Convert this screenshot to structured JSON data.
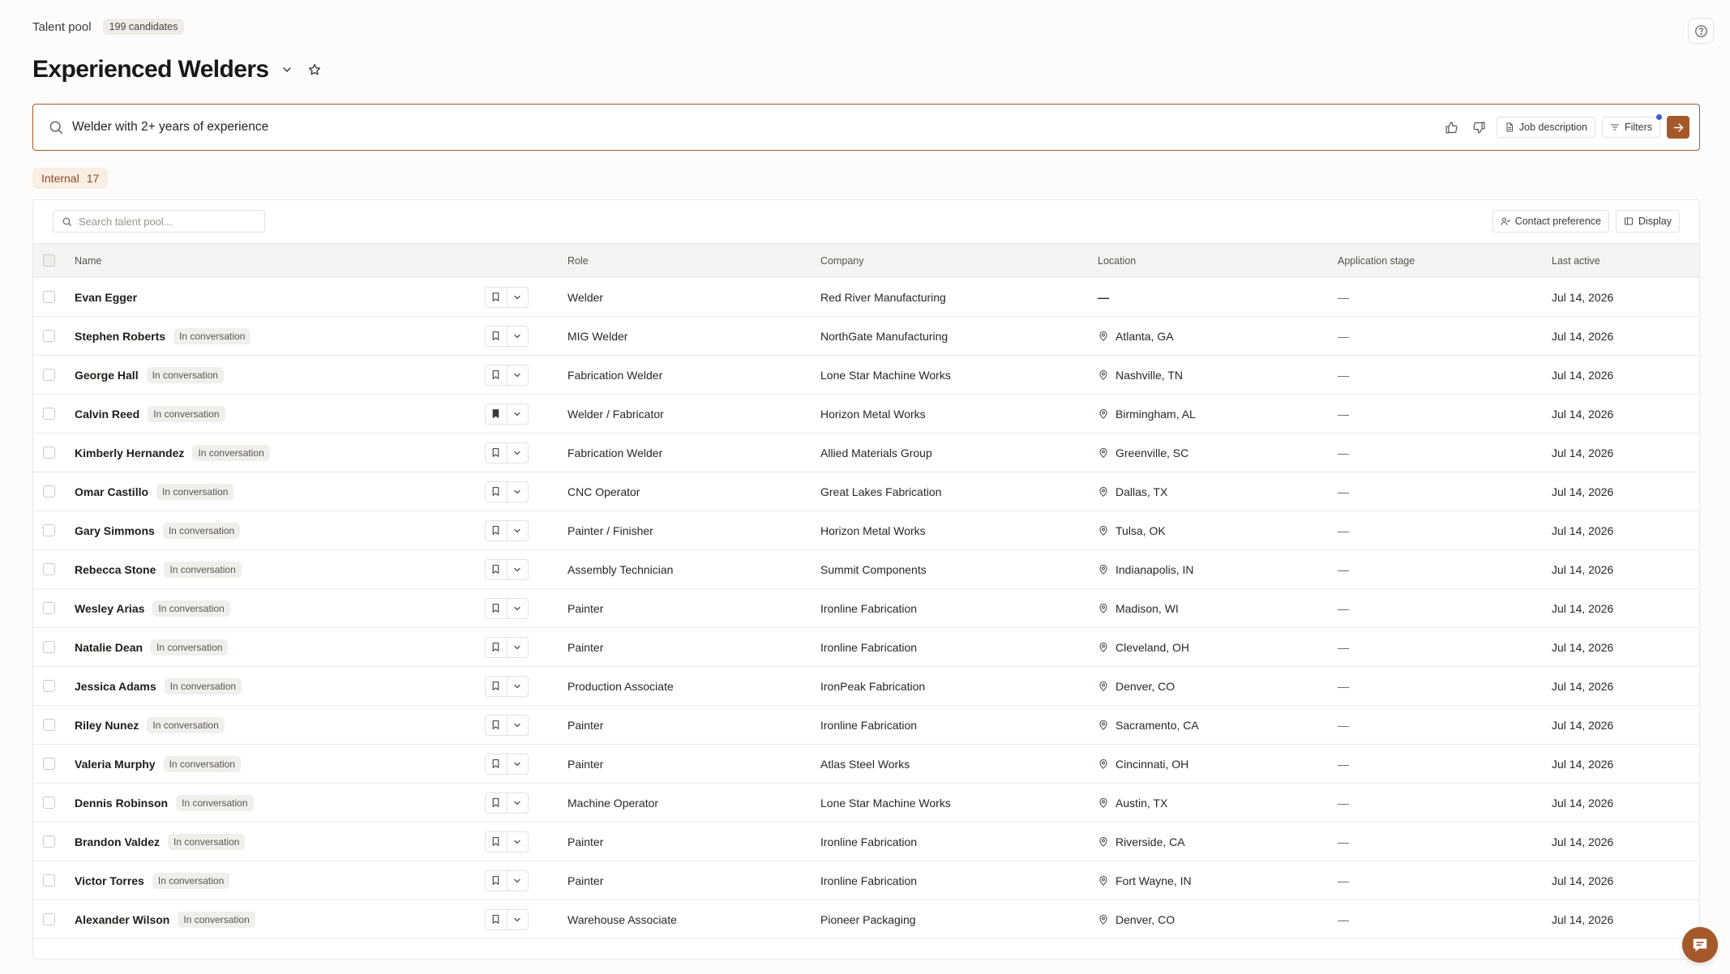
{
  "header": {
    "breadcrumb": "Talent pool",
    "candidate_count": "199 candidates",
    "title": "Experienced Welders"
  },
  "search": {
    "query": "Welder with 2+ years of experience",
    "job_description_label": "Job description",
    "filters_label": "Filters"
  },
  "tabs": {
    "internal_label": "Internal",
    "internal_count": "17"
  },
  "toolbar": {
    "search_placeholder": "Search talent pool...",
    "contact_preference_label": "Contact preference",
    "display_label": "Display"
  },
  "columns": {
    "name": "Name",
    "role": "Role",
    "company": "Company",
    "location": "Location",
    "stage": "Application stage",
    "last_active": "Last active"
  },
  "colors": {
    "accent": "#a5582a",
    "notification_dot": "#3b5bdb"
  },
  "rows": [
    {
      "name": "Evan Egger",
      "status": "",
      "role": "Welder",
      "company": "Red River Manufacturing",
      "location": "",
      "location_placeholder": "—",
      "stage": "—",
      "last_active": "Jul 14, 2026",
      "bookmarked": false
    },
    {
      "name": "Stephen Roberts",
      "status": "In conversation",
      "role": "MIG Welder",
      "company": "NorthGate Manufacturing",
      "location": "Atlanta, GA",
      "stage": "—",
      "last_active": "Jul 14, 2026",
      "bookmarked": false
    },
    {
      "name": "George Hall",
      "status": "In conversation",
      "role": "Fabrication Welder",
      "company": "Lone Star Machine Works",
      "location": "Nashville, TN",
      "stage": "—",
      "last_active": "Jul 14, 2026",
      "bookmarked": false
    },
    {
      "name": "Calvin Reed",
      "status": "In conversation",
      "role": "Welder / Fabricator",
      "company": "Horizon Metal Works",
      "location": "Birmingham, AL",
      "stage": "—",
      "last_active": "Jul 14, 2026",
      "bookmarked": true
    },
    {
      "name": "Kimberly Hernandez",
      "status": "In conversation",
      "role": "Fabrication Welder",
      "company": "Allied Materials Group",
      "location": "Greenville, SC",
      "stage": "—",
      "last_active": "Jul 14, 2026",
      "bookmarked": false
    },
    {
      "name": "Omar Castillo",
      "status": "In conversation",
      "role": "CNC Operator",
      "company": "Great Lakes Fabrication",
      "location": "Dallas, TX",
      "stage": "—",
      "last_active": "Jul 14, 2026",
      "bookmarked": false
    },
    {
      "name": "Gary Simmons",
      "status": "In conversation",
      "role": "Painter / Finisher",
      "company": "Horizon Metal Works",
      "location": "Tulsa, OK",
      "stage": "—",
      "last_active": "Jul 14, 2026",
      "bookmarked": false
    },
    {
      "name": "Rebecca Stone",
      "status": "In conversation",
      "role": "Assembly Technician",
      "company": "Summit Components",
      "location": "Indianapolis, IN",
      "stage": "—",
      "last_active": "Jul 14, 2026",
      "bookmarked": false
    },
    {
      "name": "Wesley Arias",
      "status": "In conversation",
      "role": "Painter",
      "company": "Ironline Fabrication",
      "location": "Madison, WI",
      "stage": "—",
      "last_active": "Jul 14, 2026",
      "bookmarked": false
    },
    {
      "name": "Natalie Dean",
      "status": "In conversation",
      "role": "Painter",
      "company": "Ironline Fabrication",
      "location": "Cleveland, OH",
      "stage": "—",
      "last_active": "Jul 14, 2026",
      "bookmarked": false
    },
    {
      "name": "Jessica Adams",
      "status": "In conversation",
      "role": "Production Associate",
      "company": "IronPeak Fabrication",
      "location": "Denver, CO",
      "stage": "—",
      "last_active": "Jul 14, 2026",
      "bookmarked": false
    },
    {
      "name": "Riley Nunez",
      "status": "In conversation",
      "role": "Painter",
      "company": "Ironline Fabrication",
      "location": "Sacramento, CA",
      "stage": "—",
      "last_active": "Jul 14, 2026",
      "bookmarked": false
    },
    {
      "name": "Valeria Murphy",
      "status": "In conversation",
      "role": "Painter",
      "company": "Atlas Steel Works",
      "location": "Cincinnati, OH",
      "stage": "—",
      "last_active": "Jul 14, 2026",
      "bookmarked": false
    },
    {
      "name": "Dennis Robinson",
      "status": "In conversation",
      "role": "Machine Operator",
      "company": "Lone Star Machine Works",
      "location": "Austin, TX",
      "stage": "—",
      "last_active": "Jul 14, 2026",
      "bookmarked": false
    },
    {
      "name": "Brandon Valdez",
      "status": "In conversation",
      "role": "Painter",
      "company": "Ironline Fabrication",
      "location": "Riverside, CA",
      "stage": "—",
      "last_active": "Jul 14, 2026",
      "bookmarked": false
    },
    {
      "name": "Victor Torres",
      "status": "In conversation",
      "role": "Painter",
      "company": "Ironline Fabrication",
      "location": "Fort Wayne, IN",
      "stage": "—",
      "last_active": "Jul 14, 2026",
      "bookmarked": false
    },
    {
      "name": "Alexander Wilson",
      "status": "In conversation",
      "role": "Warehouse Associate",
      "company": "Pioneer Packaging",
      "location": "Denver, CO",
      "stage": "—",
      "last_active": "Jul 14, 2026",
      "bookmarked": false
    }
  ]
}
